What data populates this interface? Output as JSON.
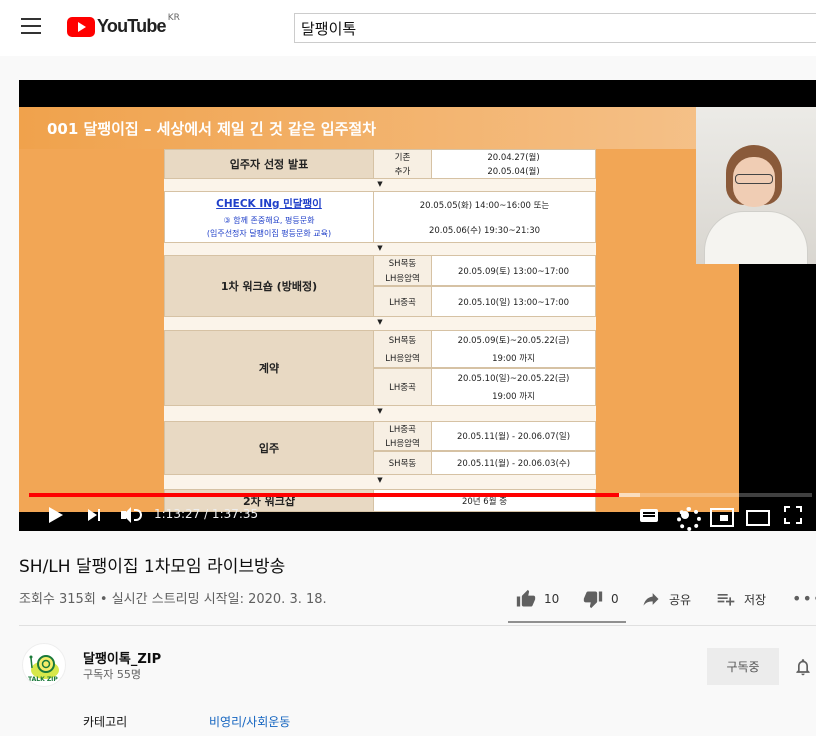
{
  "header": {
    "logo_text": "YouTube",
    "region": "KR",
    "search_value": "달팽이톡"
  },
  "slide": {
    "title": "001 달팽이집 – 세상에서 제일 긴 것 같은 입주절차",
    "rows": [
      {
        "label": "입주자 선정 발표",
        "subs": [
          "기존",
          "추가"
        ],
        "vals": [
          "20.04.27(월)",
          "20.05.04(월)"
        ]
      },
      {
        "check_title": "CHECK INg 민달팽이",
        "check_sub1": "③ 함께 존중해요, 평등문화",
        "check_sub2": "(입주선정자 달팽이집 평등문화 교육)",
        "vals": [
          "20.05.05(화) 14:00~16:00 또는",
          "20.05.06(수) 19:30~21:30"
        ]
      },
      {
        "label": "1차 워크숍 (방배정)",
        "subs1": [
          "SH목동",
          "LH응암역"
        ],
        "vals1": [
          "20.05.09(토) 13:00~17:00"
        ],
        "subs2": [
          "LH중곡"
        ],
        "vals2": [
          "20.05.10(일) 13:00~17:00"
        ]
      },
      {
        "label": "계약",
        "subs1": [
          "SH목동",
          "LH응암역"
        ],
        "vals1": [
          "20.05.09(토)~20.05.22(금)",
          "19:00 까지"
        ],
        "subs2": [
          "LH중곡"
        ],
        "vals2": [
          "20.05.10(일)~20.05.22(금)",
          "19:00 까지"
        ]
      },
      {
        "label": "입주",
        "subs1": [
          "LH중곡",
          "LH응암역"
        ],
        "vals1": [
          "20.05.11(월) - 20.06.07(일)"
        ],
        "subs2": [
          "SH목동"
        ],
        "vals2": [
          "20.05.11(월) - 20.06.03(수)"
        ]
      },
      {
        "label": "2차 워크샵",
        "vals": [
          "20년 6월 중"
        ]
      }
    ]
  },
  "player": {
    "time": "1:13:27 / 1:37:35",
    "progress_played": 0.753,
    "progress_buffered": 0.78
  },
  "video": {
    "title": "SH/LH 달팽이집 1차모임 라이브방송",
    "meta": "조회수 315회 • 실시간 스트리밍 시작일: 2020. 3. 18.",
    "likes": "10",
    "dislikes": "0",
    "share_label": "공유",
    "save_label": "저장"
  },
  "channel": {
    "name": "달팽이톡_ZIP",
    "subscribers": "구독자 55명",
    "subscribe_label": "구독중",
    "avatar_text": "TALK ZIP"
  },
  "category": {
    "label": "카테고리",
    "value": "비영리/사회운동"
  },
  "colors": {
    "accent": "#ff0000",
    "link": "#1565c0",
    "slide_orange": "#f2a655"
  }
}
